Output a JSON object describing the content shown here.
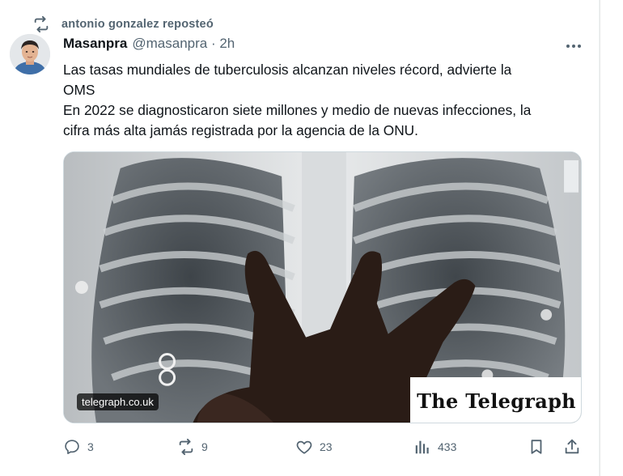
{
  "repost": {
    "icon": "repost-icon",
    "text": "antonio gonzalez reposteó"
  },
  "post": {
    "author_name": "Masanpra",
    "handle_time": "@masanpra · 2h",
    "text_lines": [
      "Las tasas mundiales de tuberculosis alcanzan niveles récord, advierte la",
      "OMS",
      "En 2022 se diagnosticaron siete millones y medio de nuevas infecciones, la",
      "cifra más alta jamás registrada por la agencia de la ONU."
    ],
    "media": {
      "domain": "telegraph.co.uk",
      "logo_text": "The Telegraph"
    }
  },
  "actions": {
    "replies": "3",
    "reposts": "9",
    "likes": "23",
    "views": "433"
  },
  "colors": {
    "text": "#0f1419",
    "muted": "#536471",
    "border": "#cfd9de"
  }
}
